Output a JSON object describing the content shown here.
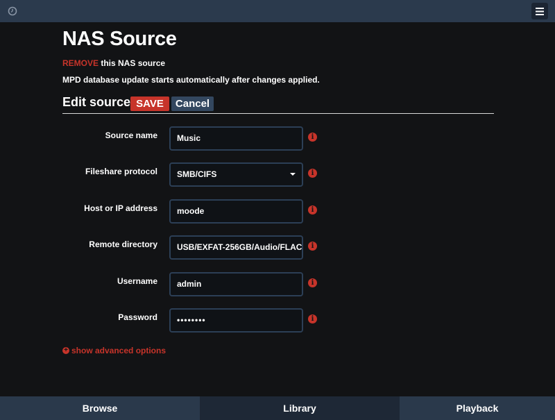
{
  "topbar": {
    "left_icon": "clock-icon",
    "menu_icon": "hamburger-icon"
  },
  "page": {
    "title": "NAS Source",
    "remove_link": "REMOVE",
    "remove_suffix": " this NAS source",
    "update_note": "MPD database update starts automatically after changes applied."
  },
  "section": {
    "title": "Edit source",
    "save_label": "SAVE",
    "cancel_label": "Cancel"
  },
  "form": {
    "source_name": {
      "label": "Source name",
      "value": "Music"
    },
    "protocol": {
      "label": "Fileshare protocol",
      "value": "SMB/CIFS"
    },
    "host": {
      "label": "Host or IP address",
      "value": "moode"
    },
    "remote_dir": {
      "label": "Remote directory",
      "value": "USB/EXFAT-256GB/Audio/FLAC"
    },
    "username": {
      "label": "Username",
      "value": "admin"
    },
    "password": {
      "label": "Password",
      "value": "••••••••"
    }
  },
  "advanced": {
    "label": "show advanced options"
  },
  "nav": {
    "browse": "Browse",
    "library": "Library",
    "playback": "Playback"
  },
  "colors": {
    "accent_red": "#c7342a",
    "topbar": "#2b3a4d",
    "background": "#121315"
  }
}
